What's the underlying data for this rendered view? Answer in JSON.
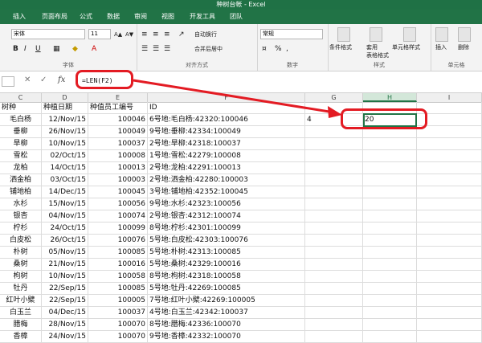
{
  "window": {
    "title": "种树台帐 - Excel"
  },
  "tabs": [
    "插入",
    "页面布局",
    "公式",
    "数据",
    "审阅",
    "视图",
    "开发工具",
    "团队"
  ],
  "ribbon": {
    "font": {
      "name": "宋体",
      "size": "11",
      "bold": "B",
      "italic": "I",
      "underline": "U",
      "group_label": "字体"
    },
    "alignment": {
      "wrap_text": "自动换行",
      "merge_center": "合并后居中",
      "group_label": "对齐方式"
    },
    "number": {
      "format": "常规",
      "group_label": "数字",
      "percent": "%",
      "comma": ","
    },
    "styles": {
      "conditional": "条件格式",
      "table": "套用\n表格格式",
      "cell_styles": "单元格样式",
      "group_label": "样式"
    },
    "cells": {
      "insert": "插入",
      "delete": "删除",
      "group_label": "单元格"
    }
  },
  "formula_bar": {
    "formula": "=LEN(F2)",
    "fx": "fx"
  },
  "columns": [
    "C",
    "D",
    "E",
    "F",
    "G",
    "H",
    "I"
  ],
  "sheet": {
    "headers": [
      "树种",
      "种植日期",
      "种值员工编号",
      "ID",
      "",
      "",
      ""
    ],
    "rows": [
      [
        "毛白杨",
        "12/Nov/15",
        "100046",
        "6号地:毛白杨:42320:100046",
        "4",
        "20",
        ""
      ],
      [
        "垂柳",
        "26/Nov/15",
        "100049",
        "9号地:垂柳:42334:100049",
        "",
        "",
        ""
      ],
      [
        "旱柳",
        "10/Nov/15",
        "100037",
        "2号地:旱柳:42318:100037",
        "",
        "",
        ""
      ],
      [
        "雪松",
        "02/Oct/15",
        "100008",
        "1号地:雪松:42279:100008",
        "",
        "",
        ""
      ],
      [
        "龙柏",
        "14/Oct/15",
        "100013",
        "2号地:龙柏:42291:100013",
        "",
        "",
        ""
      ],
      [
        "洒金柏",
        "03/Oct/15",
        "100003",
        "2号地:洒金柏:42280:100003",
        "",
        "",
        ""
      ],
      [
        "铺地柏",
        "14/Dec/15",
        "100045",
        "3号地:铺地柏:42352:100045",
        "",
        "",
        ""
      ],
      [
        "水杉",
        "15/Nov/15",
        "100056",
        "9号地:水杉:42323:100056",
        "",
        "",
        ""
      ],
      [
        "银杏",
        "04/Nov/15",
        "100074",
        "2号地:银杏:42312:100074",
        "",
        "",
        ""
      ],
      [
        "柠杉",
        "24/Oct/15",
        "100099",
        "8号地:柠杉:42301:100099",
        "",
        "",
        ""
      ],
      [
        "白皮松",
        "26/Oct/15",
        "100076",
        "5号地:白皮松:42303:100076",
        "",
        "",
        ""
      ],
      [
        "朴树",
        "05/Nov/15",
        "100085",
        "5号地:朴树:42313:100085",
        "",
        "",
        ""
      ],
      [
        "桑树",
        "21/Nov/15",
        "100016",
        "5号地:桑树:42329:100016",
        "",
        "",
        ""
      ],
      [
        "枸树",
        "10/Nov/15",
        "100058",
        "8号地:枸树:42318:100058",
        "",
        "",
        ""
      ],
      [
        "牡丹",
        "22/Sep/15",
        "100085",
        "5号地:牡丹:42269:100085",
        "",
        "",
        ""
      ],
      [
        "红叶小檗",
        "22/Sep/15",
        "100005",
        "7号地:红叶小檗:42269:100005",
        "",
        "",
        ""
      ],
      [
        "白玉兰",
        "04/Dec/15",
        "100037",
        "4号地:白玉兰:42342:100037",
        "",
        "",
        ""
      ],
      [
        "腊梅",
        "28/Nov/15",
        "100070",
        "8号地:腊梅:42336:100070",
        "",
        "",
        ""
      ],
      [
        "香樟",
        "24/Nov/15",
        "100070",
        "9号地:香樟:42332:100070",
        "",
        "",
        ""
      ]
    ]
  },
  "colors": {
    "excel_green": "#217346",
    "annotation_red": "#e31b23"
  }
}
